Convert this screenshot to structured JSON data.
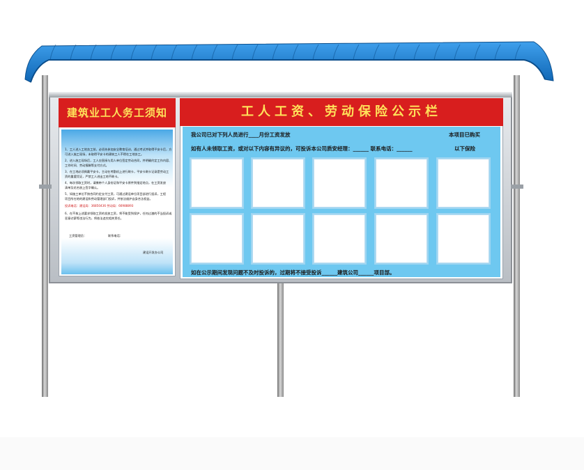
{
  "colors": {
    "canopy": "#1a7fd0",
    "title_bar": "#d81e1e",
    "title_text": "#ffe25a",
    "panel_blue": "#6ec8f0"
  },
  "left_board": {
    "title": "建筑业工人务工须知",
    "rules": [
      "1、工人进入工地务工前，必须先参加安全教育培训，通过考试并取得平安卡后，方",
      "   可进入施工现场，未取得平安卡的建筑工人不得在工地务工。",
      "2、进入施工现场后，工人应直接与用人单位签定劳动合同，并明确约定工作内容、",
      "   工作时间、劳动报酬等支付方式。",
      "3、在工地必须佩戴平安卡，主动在考勤机上进行刷卡，平安卡刷卡记录是劳动工",
      "   资的重要凭证，严禁工人进出工地不刷卡。",
      "4、每次领取工资时，请携带个人身份证和平安卡原件到指定地点，在工资发放",
      "   清单及花名册上签字确认。",
      "5、如施工单位不按合同约定支付工资，可通过建设单位项目部进行投诉，工程",
      "   项目所在地的建设和劳动管理部门投诉，并依法维护自身合法权益。"
    ],
    "hotline": "投诉电话：建设局：36850436  劳动局：66988893",
    "rule6": [
      "6、在不按上述要求领取工资的发放工资，将不能受到保护，任何过激的不当投诉或",
      "   恶意讨薪等违法行为，将依法追究相关责任。"
    ],
    "manager": "工资管理员：",
    "phone": "联系电话：",
    "footer": "建设开发办公司"
  },
  "right_board": {
    "title": "工人工资、劳动保险公示栏",
    "line1": "我公司已对下列人员进行____月份工资发放",
    "line2": "如有人未领取工资，或对以下内容有异议的，可投诉本公司质安经理：______  联系电话：______",
    "insurance_1": "本项目已购买",
    "insurance_2": "以下保险",
    "photo_slots": 10,
    "bottom": "如在公示期间发现问题不及时投诉的，过期将不接受投诉______建筑公司______项目部。"
  }
}
